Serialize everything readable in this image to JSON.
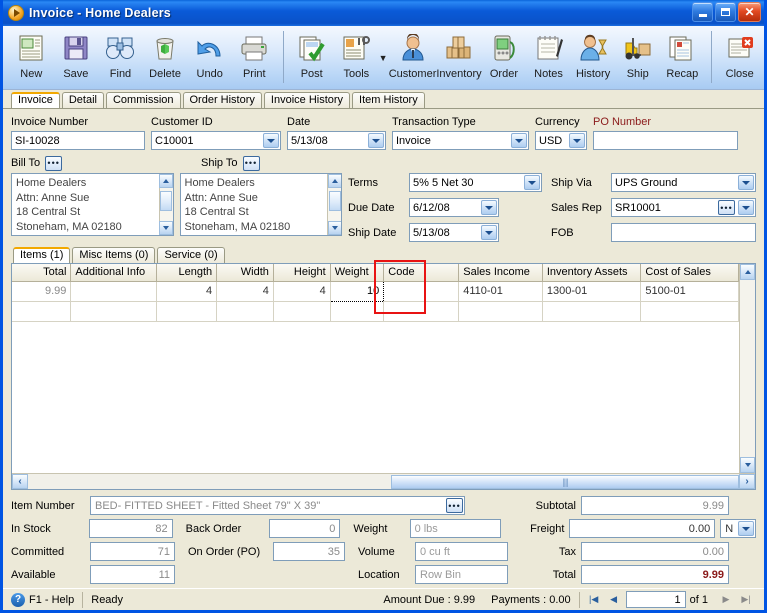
{
  "window": {
    "title": "Invoice - Home Dealers",
    "icon": "play-circle-icon",
    "buttons": {
      "minimize": "minimize-icon",
      "maximize": "maximize-icon",
      "close": "close-icon"
    }
  },
  "toolbar": {
    "items": [
      {
        "label": "New",
        "icon": "new-document-icon"
      },
      {
        "label": "Save",
        "icon": "floppy-disk-icon"
      },
      {
        "label": "Find",
        "icon": "binoculars-icon"
      },
      {
        "label": "Delete",
        "icon": "recycle-bin-icon"
      },
      {
        "label": "Undo",
        "icon": "undo-arrow-icon"
      },
      {
        "label": "Print",
        "icon": "printer-icon"
      },
      {
        "label": "Post",
        "icon": "post-check-icon"
      },
      {
        "label": "Tools",
        "icon": "tools-icon"
      },
      {
        "label": "Customer",
        "icon": "customer-person-icon"
      },
      {
        "label": "Inventory",
        "icon": "boxes-icon"
      },
      {
        "label": "Order",
        "icon": "order-device-icon"
      },
      {
        "label": "Notes",
        "icon": "notepad-pen-icon"
      },
      {
        "label": "History",
        "icon": "history-person-icon"
      },
      {
        "label": "Ship",
        "icon": "forklift-icon"
      },
      {
        "label": "Recap",
        "icon": "recap-pages-icon"
      },
      {
        "label": "Close",
        "icon": "close-window-icon"
      }
    ]
  },
  "tabs": [
    {
      "label": "Invoice",
      "active": true
    },
    {
      "label": "Detail",
      "active": false
    },
    {
      "label": "Commission",
      "active": false
    },
    {
      "label": "Order History",
      "active": false
    },
    {
      "label": "Invoice History",
      "active": false
    },
    {
      "label": "Item History",
      "active": false
    }
  ],
  "form": {
    "invoice_number": {
      "label": "Invoice Number",
      "value": "SI-10028"
    },
    "customer_id": {
      "label": "Customer ID",
      "value": "C10001"
    },
    "date": {
      "label": "Date",
      "value": "5/13/08"
    },
    "transaction_type": {
      "label": "Transaction Type",
      "value": "Invoice"
    },
    "currency": {
      "label": "Currency",
      "value": "USD"
    },
    "po_number": {
      "label": "PO Number",
      "value": "",
      "label_color": "#8b1a1a"
    },
    "bill_to": {
      "label": "Bill To",
      "lines": [
        "Home Dealers",
        "Attn: Anne Sue",
        "18 Central St",
        "Stoneham, MA 02180"
      ]
    },
    "ship_to": {
      "label": "Ship To",
      "lines": [
        "Home Dealers",
        "Attn: Anne Sue",
        "18 Central St",
        "Stoneham, MA 02180"
      ]
    },
    "terms": {
      "label": "Terms",
      "value": "5% 5 Net 30"
    },
    "due_date": {
      "label": "Due Date",
      "value": "6/12/08"
    },
    "ship_date": {
      "label": "Ship Date",
      "value": "5/13/08"
    },
    "ship_via": {
      "label": "Ship Via",
      "value": "UPS Ground"
    },
    "sales_rep": {
      "label": "Sales Rep",
      "value": "SR10001"
    },
    "fob": {
      "label": "FOB",
      "value": ""
    }
  },
  "grid": {
    "tabs": [
      {
        "label": "Items (1)",
        "active": true
      },
      {
        "label": "Misc Items (0)",
        "active": false
      },
      {
        "label": "Service (0)",
        "active": false
      }
    ],
    "columns": [
      "Total",
      "Additional Info",
      "Length",
      "Width",
      "Height",
      "Weight",
      "Code",
      "Sales Income",
      "Inventory Assets",
      "Cost of Sales"
    ],
    "rows": [
      {
        "Total": "9.99",
        "Additional Info": "",
        "Length": "4",
        "Width": "4",
        "Height": "4",
        "Weight": "10",
        "Code": "",
        "Sales Income": "4110-01",
        "Inventory Assets": "1300-01",
        "Cost of Sales": "5100-01"
      }
    ],
    "highlight_column": "Weight",
    "highlight_color": "#e81313"
  },
  "item_detail": {
    "item_number": {
      "label": "Item Number",
      "value": "BED- FITTED SHEET - Fitted Sheet 79\" X 39\""
    },
    "in_stock": {
      "label": "In Stock",
      "value": "82"
    },
    "committed": {
      "label": "Committed",
      "value": "71"
    },
    "available": {
      "label": "Available",
      "value": "11"
    },
    "back_order": {
      "label": "Back Order",
      "value": "0"
    },
    "on_order_po": {
      "label": "On Order (PO)",
      "value": "35"
    },
    "weight": {
      "label": "Weight",
      "placeholder": "0 lbs"
    },
    "volume": {
      "label": "Volume",
      "placeholder": "0 cu ft"
    },
    "location": {
      "label": "Location",
      "placeholder": "Row  Bin"
    }
  },
  "totals": {
    "subtotal": {
      "label": "Subtotal",
      "value": "9.99"
    },
    "freight": {
      "label": "Freight",
      "value": "0.00",
      "taxable": "N"
    },
    "tax": {
      "label": "Tax",
      "value": "0.00"
    },
    "total": {
      "label": "Total",
      "value": "9.99",
      "color": "#8b1a1a"
    }
  },
  "statusbar": {
    "help": "F1 - Help",
    "state": "Ready",
    "amount_due": "Amount Due : 9.99",
    "payments": "Payments : 0.00",
    "page_current": "1",
    "page_of": "of  1",
    "nav": {
      "first": "first-page-icon",
      "prev": "prev-page-icon",
      "next": "next-page-icon",
      "last": "last-page-icon"
    }
  }
}
